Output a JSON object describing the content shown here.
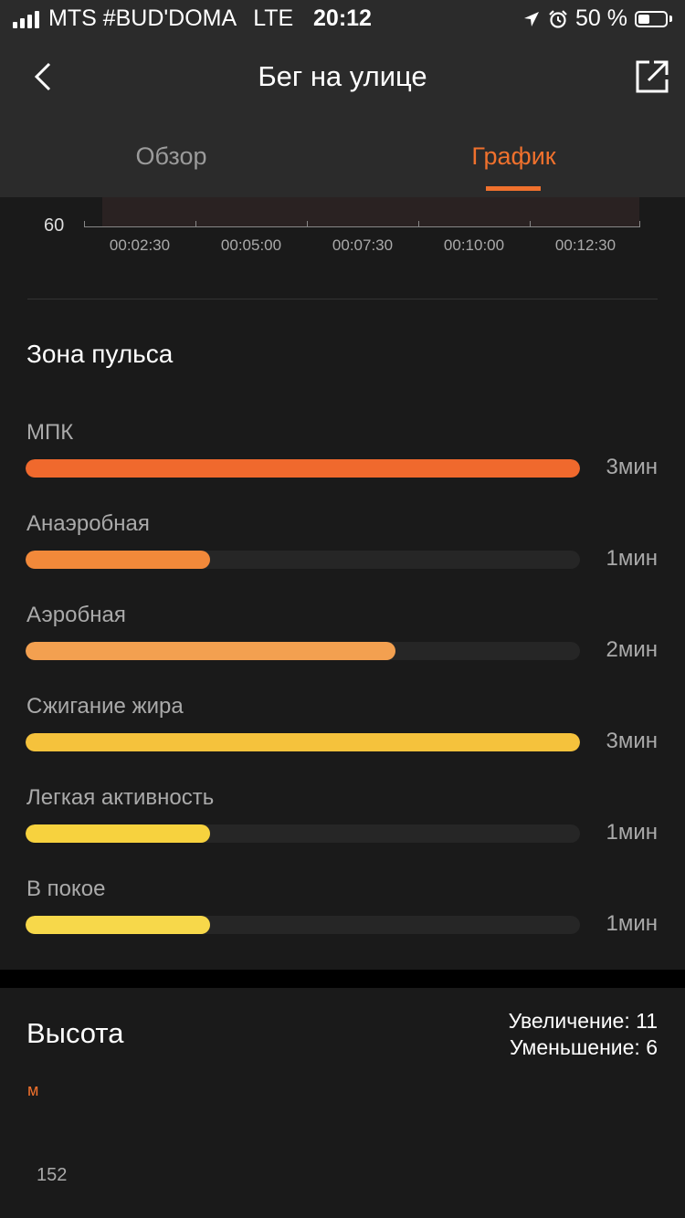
{
  "status_bar": {
    "carrier": "MTS #BUD'DOMA",
    "network": "LTE",
    "time": "20:12",
    "battery": "50 %"
  },
  "header": {
    "title": "Бег на улице",
    "tabs": [
      {
        "label": "Обзор",
        "active": false
      },
      {
        "label": "График",
        "active": true
      }
    ]
  },
  "hr_chart": {
    "y_tick": "60",
    "x_ticks": [
      "00:02:30",
      "00:05:00",
      "00:07:30",
      "00:10:00",
      "00:12:30"
    ]
  },
  "heart_zones": {
    "title": "Зона пульса",
    "zones": [
      {
        "label": "МПК",
        "value": "3мин",
        "fraction": 1.0,
        "color": "#f0692d"
      },
      {
        "label": "Анаэробная",
        "value": "1мин",
        "fraction": 0.333,
        "color": "#f2893a"
      },
      {
        "label": "Аэробная",
        "value": "2мин",
        "fraction": 0.667,
        "color": "#f3a050"
      },
      {
        "label": "Сжигание жира",
        "value": "3мин",
        "fraction": 1.0,
        "color": "#f5c23c"
      },
      {
        "label": "Легкая активность",
        "value": "1мин",
        "fraction": 0.333,
        "color": "#f7d23e"
      },
      {
        "label": "В покое",
        "value": "1мин",
        "fraction": 0.333,
        "color": "#f7d84a"
      }
    ]
  },
  "elevation": {
    "title": "Высота",
    "increase": "Увеличение: 11",
    "decrease": "Уменьшение: 6",
    "unit": "м",
    "y_tick": "152"
  },
  "colors": {
    "accent": "#f0712d",
    "header_bg": "#2b2b2b",
    "card_bg": "#1a1a1a"
  }
}
